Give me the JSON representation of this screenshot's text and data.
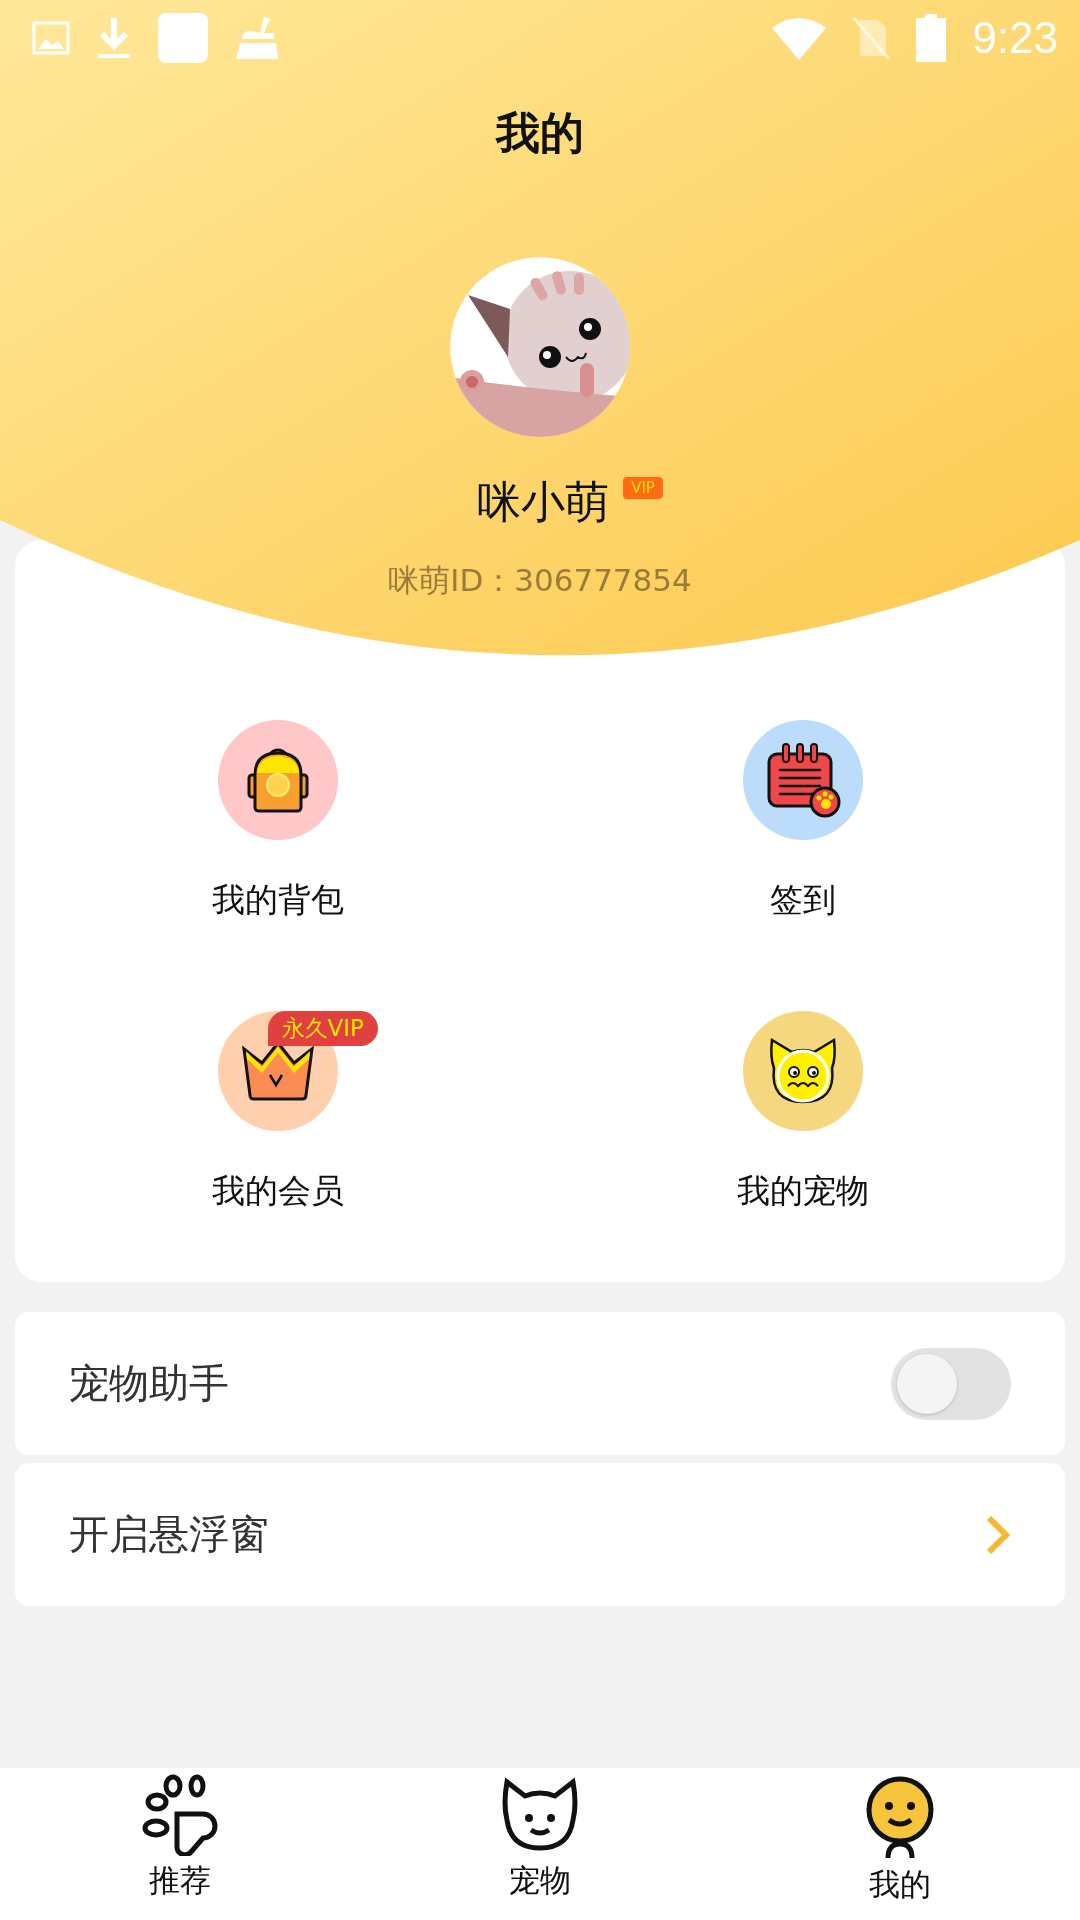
{
  "status_bar": {
    "time": "9:23"
  },
  "title": "我的",
  "profile": {
    "name": "咪小萌",
    "vip_badge": "VIP",
    "id_text": "咪萌ID：306777854"
  },
  "grid": [
    {
      "label": "我的背包"
    },
    {
      "label": "签到"
    },
    {
      "label": "我的会员",
      "badge": "永久VIP"
    },
    {
      "label": "我的宠物"
    }
  ],
  "settings": [
    {
      "kind": "toggle",
      "label": "宠物助手",
      "on": false
    },
    {
      "kind": "link",
      "label": "开启悬浮窗"
    }
  ],
  "nav": [
    {
      "label": "推荐",
      "selected": false
    },
    {
      "label": "宠物",
      "selected": false
    },
    {
      "label": "我的",
      "selected": true
    }
  ]
}
